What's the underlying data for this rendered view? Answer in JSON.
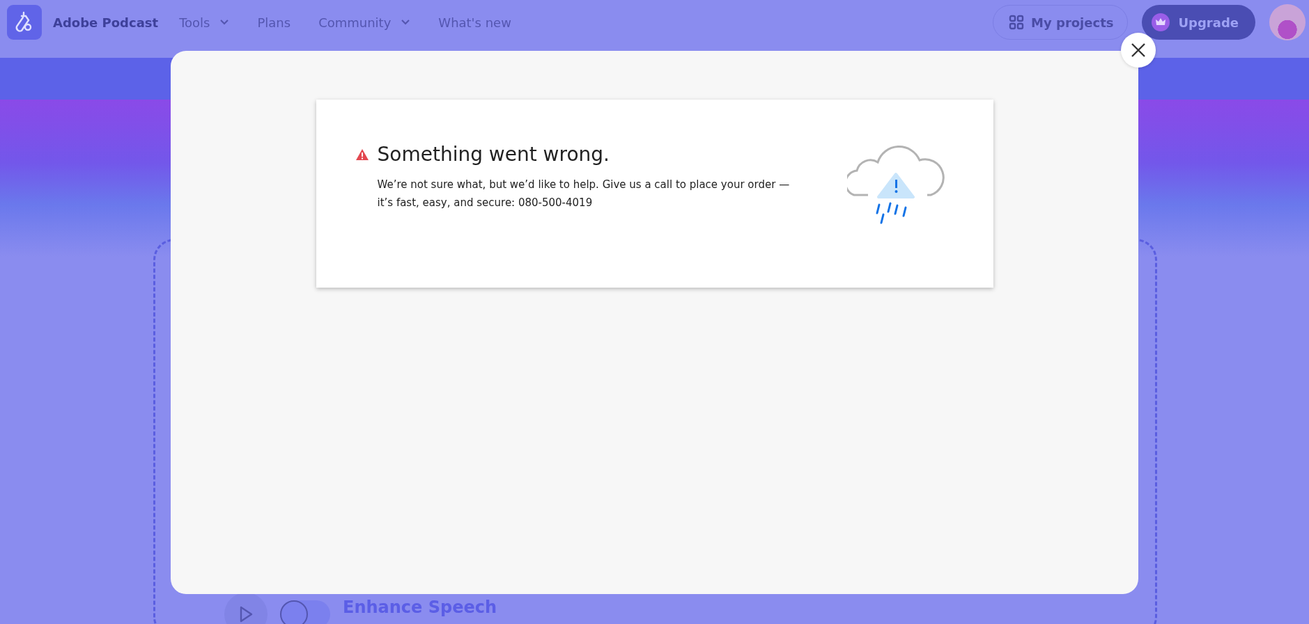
{
  "header": {
    "brand": "Adobe Podcast",
    "nav": [
      {
        "label": "Tools",
        "has_dropdown": true
      },
      {
        "label": "Plans",
        "has_dropdown": false
      },
      {
        "label": "Community",
        "has_dropdown": true
      },
      {
        "label": "What's new",
        "has_dropdown": false
      }
    ],
    "my_projects": "My projects",
    "upgrade": "Upgrade"
  },
  "background": {
    "toggle_on": false,
    "tool_label": "Enhance Speech"
  },
  "dialog": {
    "title": "Something went wrong.",
    "message": "We’re not sure what, but we’d like to help. Give us a call to place your order — it’s fast, easy, and secure: 080-500-4019"
  }
}
